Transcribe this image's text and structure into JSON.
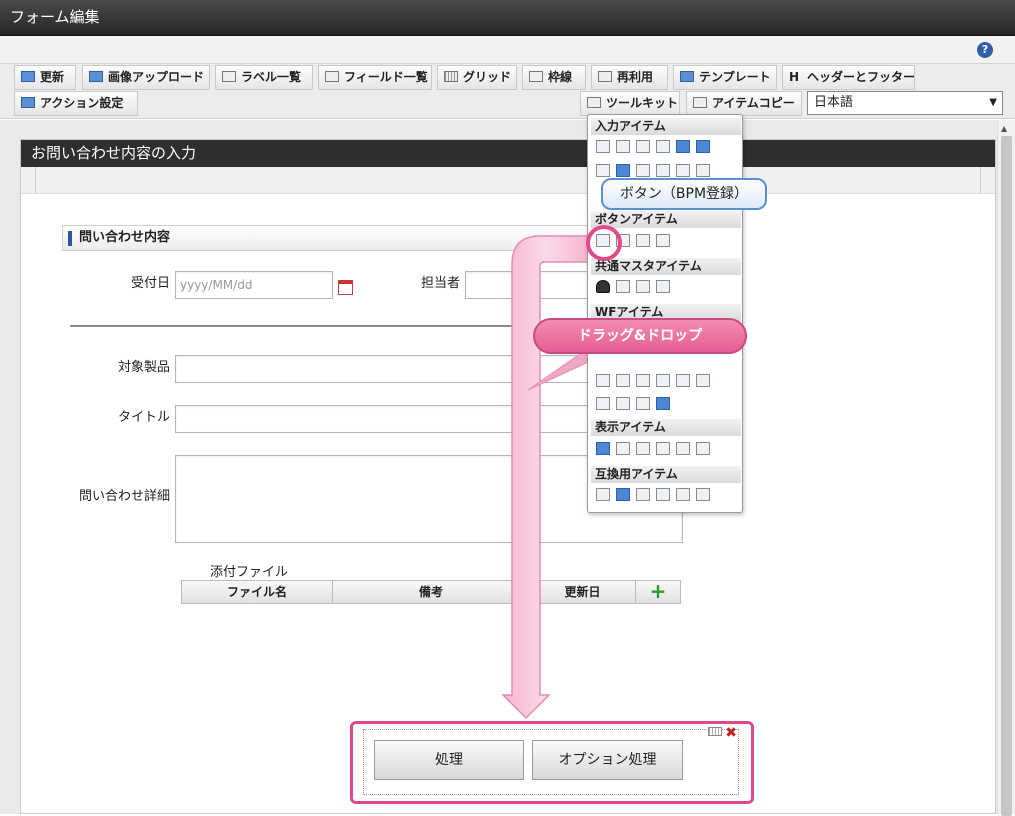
{
  "window": {
    "title": "フォーム編集"
  },
  "help": {
    "icon": "help-icon",
    "glyph": "?"
  },
  "toolbar": {
    "row1": [
      "更新",
      "画像アップロード",
      "ラベル一覧",
      "フィールド一覧",
      "グリッド",
      "枠線",
      "再利用",
      "テンプレート",
      "ヘッダーとフッター"
    ],
    "row2": [
      "アクション設定",
      "ツールキット",
      "アイテムコピー"
    ],
    "language": "日本語",
    "header_footer_glyph": "H"
  },
  "form": {
    "header": "お問い合わせ内容の入力",
    "section_title": "問い合わせ内容",
    "fields": {
      "date_label": "受付日",
      "date_placeholder": "yyyy/MM/dd",
      "owner_label": "担当者",
      "product_label": "対象製品",
      "title_label": "タイトル",
      "detail_label": "問い合わせ詳細"
    },
    "attachments": {
      "label": "添付ファイル",
      "columns": [
        "ファイル名",
        "備考",
        "更新日"
      ],
      "add_glyph": "+"
    }
  },
  "palette": {
    "sections": [
      "入力アイテム",
      "ボタンアイテム",
      "共通マスタアイテム",
      "WFアイテム",
      "表示アイテム",
      "互換用アイテム"
    ]
  },
  "callouts": {
    "button_tooltip": "ボタン（BPM登録）",
    "drag_label": "ドラッグ&ドロップ"
  },
  "drop_area": {
    "buttons": [
      "処理",
      "オプション処理"
    ],
    "close_glyph": "✖"
  },
  "colors": {
    "accent_pink": "#e04a8a",
    "header_dark": "#2e2e2e",
    "tooltip_border": "#5b90d0"
  }
}
